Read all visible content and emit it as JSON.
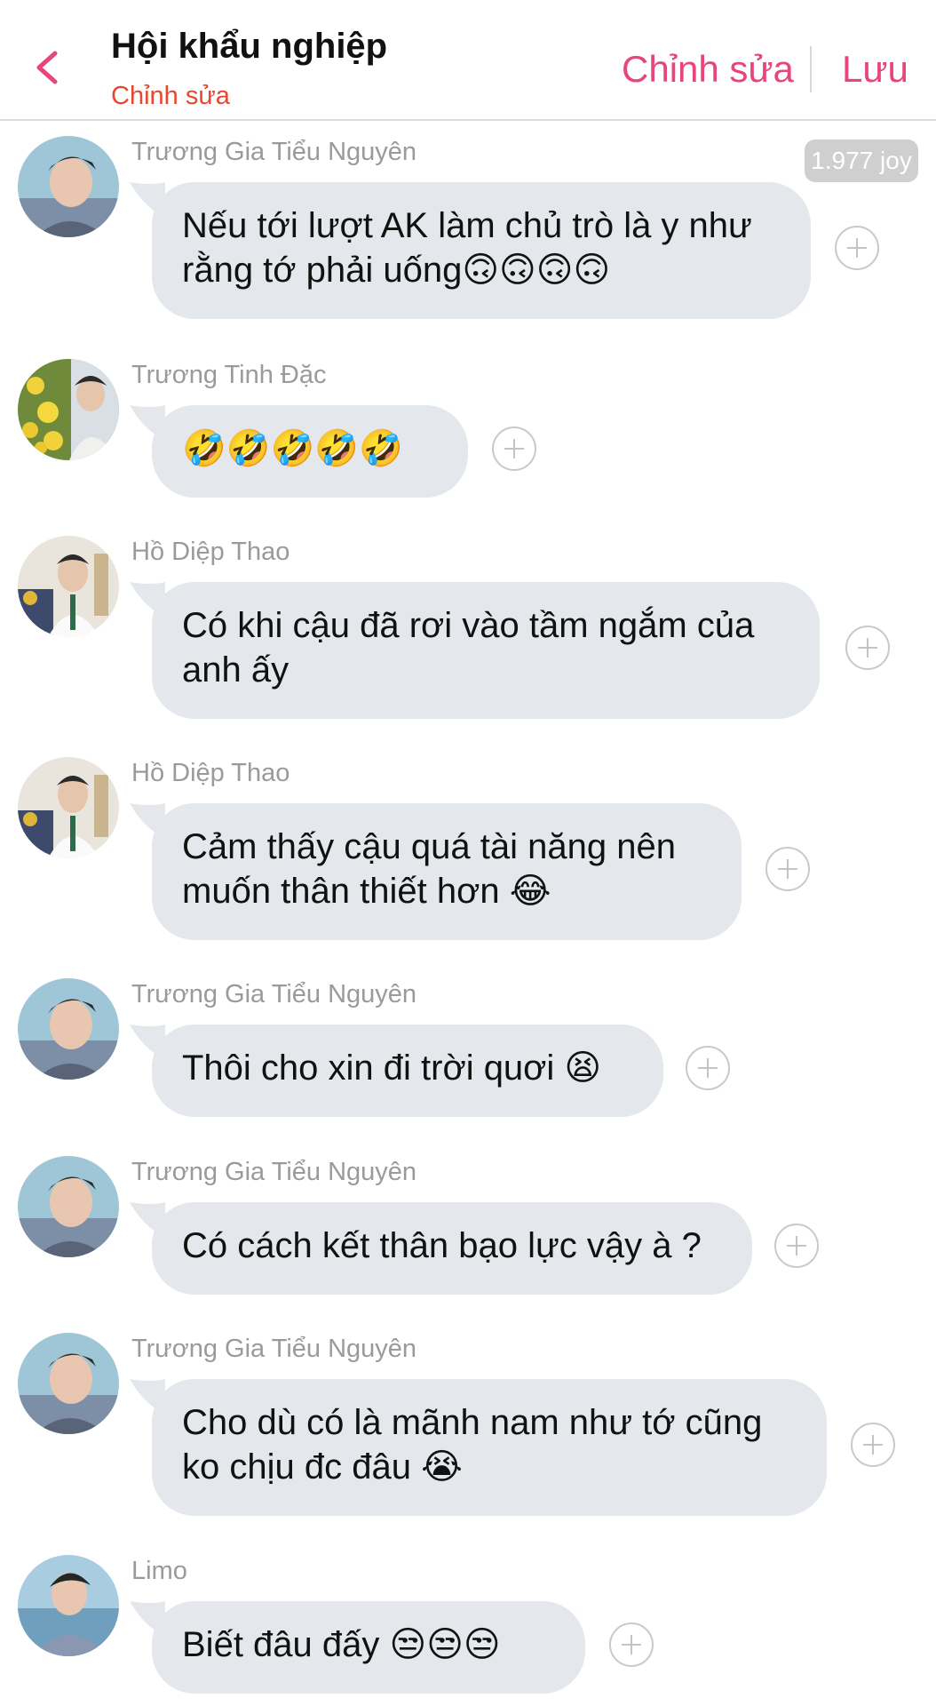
{
  "header": {
    "title": "Hội khẩu nghiệp",
    "subtitle": "Chỉnh sửa",
    "edit_label": "Chỉnh sửa",
    "save_label": "Lưu"
  },
  "joy_badge": "1.977 joy",
  "colors": {
    "accent": "#e8457b",
    "subtitle": "#e5472f",
    "bubble": "#e4e7eb",
    "sender": "#9a9a9a"
  },
  "messages": [
    {
      "sender": "Trương Gia Tiểu Nguyên",
      "text": "Nếu tới lượt AK làm chủ trò là y như rằng tớ phải uống🙃🙃🙃🙃"
    },
    {
      "sender": "Trương Tinh Đặc",
      "text": "🤣🤣🤣🤣🤣"
    },
    {
      "sender": "Hồ Diệp Thao",
      "text": "Có khi cậu đã rơi vào tầm ngắm của anh ấy"
    },
    {
      "sender": "Hồ Diệp Thao",
      "text": "Cảm thấy cậu quá tài năng nên muốn thân thiết hơn 😂"
    },
    {
      "sender": "Trương Gia Tiểu Nguyên",
      "text": "Thôi cho xin đi trời quơi 😫"
    },
    {
      "sender": "Trương Gia Tiểu Nguyên",
      "text": "Có cách kết thân bạo lực vậy à ?"
    },
    {
      "sender": "Trương Gia Tiểu Nguyên",
      "text": "Cho dù có là mãnh nam như tớ cũng ko chịu đc đâu 😭"
    },
    {
      "sender": "Limo",
      "text": "Biết đâu đấy 😒😒😒"
    }
  ]
}
